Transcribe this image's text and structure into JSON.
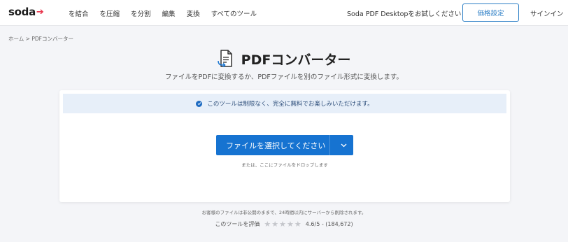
{
  "header": {
    "logo_text": "soda",
    "nav": [
      "を結合",
      "を圧縮",
      "を分割",
      "編集",
      "変換",
      "すべてのツール"
    ],
    "try_desktop": "Soda PDF Desktopをお試しください",
    "pricing": "価格設定",
    "signin": "サインイン"
  },
  "breadcrumb": "ホーム > PDFコンバーター",
  "main": {
    "title": "PDFコンバーター",
    "subtitle": "ファイルをPDFに変換するか、PDFファイルを別のファイル形式に変換します。",
    "notice": "このツールは制限なく、完全に無料でお楽しみいただけます。",
    "choose_button": "ファイルを選択してください",
    "drop_hint": "または、ここにファイルをドロップします"
  },
  "footer": {
    "privacy": "お客様のファイルは非公開のままで、24時間以内にサーバーから削除されます。",
    "rate_label": "このツールを評価",
    "rating": "4.6/5 - (184,672)"
  },
  "colors": {
    "brand_red": "#e8334a",
    "accent_blue": "#1673d1",
    "notice_bg": "#e7eff9"
  },
  "icons": {
    "logo": "arrow-right-icon",
    "title": "document-convert-icon",
    "notice": "check-circle-icon",
    "dropdown": "chevron-down-icon",
    "rating": "star-icon"
  }
}
